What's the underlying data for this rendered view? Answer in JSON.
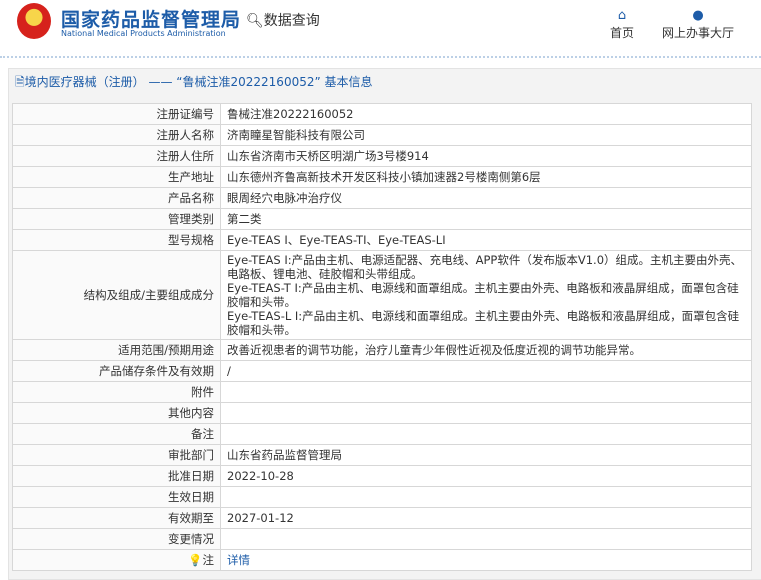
{
  "header": {
    "title": "国家药品监督管理局",
    "subtitle": "National Medical Products Administration",
    "query": "数据查询",
    "nav": [
      {
        "label": "首页",
        "icon": "home-icon"
      },
      {
        "label": "网上办事大厅",
        "icon": "user-icon"
      }
    ]
  },
  "panel": {
    "title": "境内医疗器械（注册） —— “鲁械注准20222160052” 基本信息"
  },
  "rows": [
    {
      "label": "注册证编号",
      "value": "鲁械注准20222160052"
    },
    {
      "label": "注册人名称",
      "value": "济南瞳星智能科技有限公司"
    },
    {
      "label": "注册人住所",
      "value": "山东省济南市天桥区明湖广场3号楼914"
    },
    {
      "label": "生产地址",
      "value": "山东德州齐鲁高新技术开发区科技小镇加速器2号楼南侧第6层"
    },
    {
      "label": "产品名称",
      "value": "眼周经穴电脉冲治疗仪"
    },
    {
      "label": "管理类别",
      "value": "第二类"
    },
    {
      "label": "型号规格",
      "value": "Eye-TEAS Ⅰ、Eye-TEAS-TⅠ、Eye-TEAS-LⅠ"
    },
    {
      "label": "结构及组成/主要组成成分",
      "value": "Eye-TEAS I:产品由主机、电源适配器、充电线、APP软件（发布版本V1.0）组成。主机主要由外壳、电路板、锂电池、硅胶帽和头带组成。\nEye-TEAS-T I:产品由主机、电源线和面罩组成。主机主要由外壳、电路板和液晶屏组成，面罩包含硅胶帽和头带。\nEye-TEAS-L I:产品由主机、电源线和面罩组成。主机主要由外壳、电路板和液晶屏组成，面罩包含硅胶帽和头带。"
    },
    {
      "label": "适用范围/预期用途",
      "value": "改善近视患者的调节功能，治疗儿童青少年假性近视及低度近视的调节功能异常。"
    },
    {
      "label": "产品储存条件及有效期",
      "value": "/"
    },
    {
      "label": "附件",
      "value": ""
    },
    {
      "label": "其他内容",
      "value": ""
    },
    {
      "label": "备注",
      "value": ""
    },
    {
      "label": "审批部门",
      "value": "山东省药品监督管理局"
    },
    {
      "label": "批准日期",
      "value": "2022-10-28"
    },
    {
      "label": "生效日期",
      "value": ""
    },
    {
      "label": "有效期至",
      "value": "2027-01-12"
    },
    {
      "label": "变更情况",
      "value": ""
    }
  ],
  "note": {
    "label": "注",
    "link": "详情"
  }
}
